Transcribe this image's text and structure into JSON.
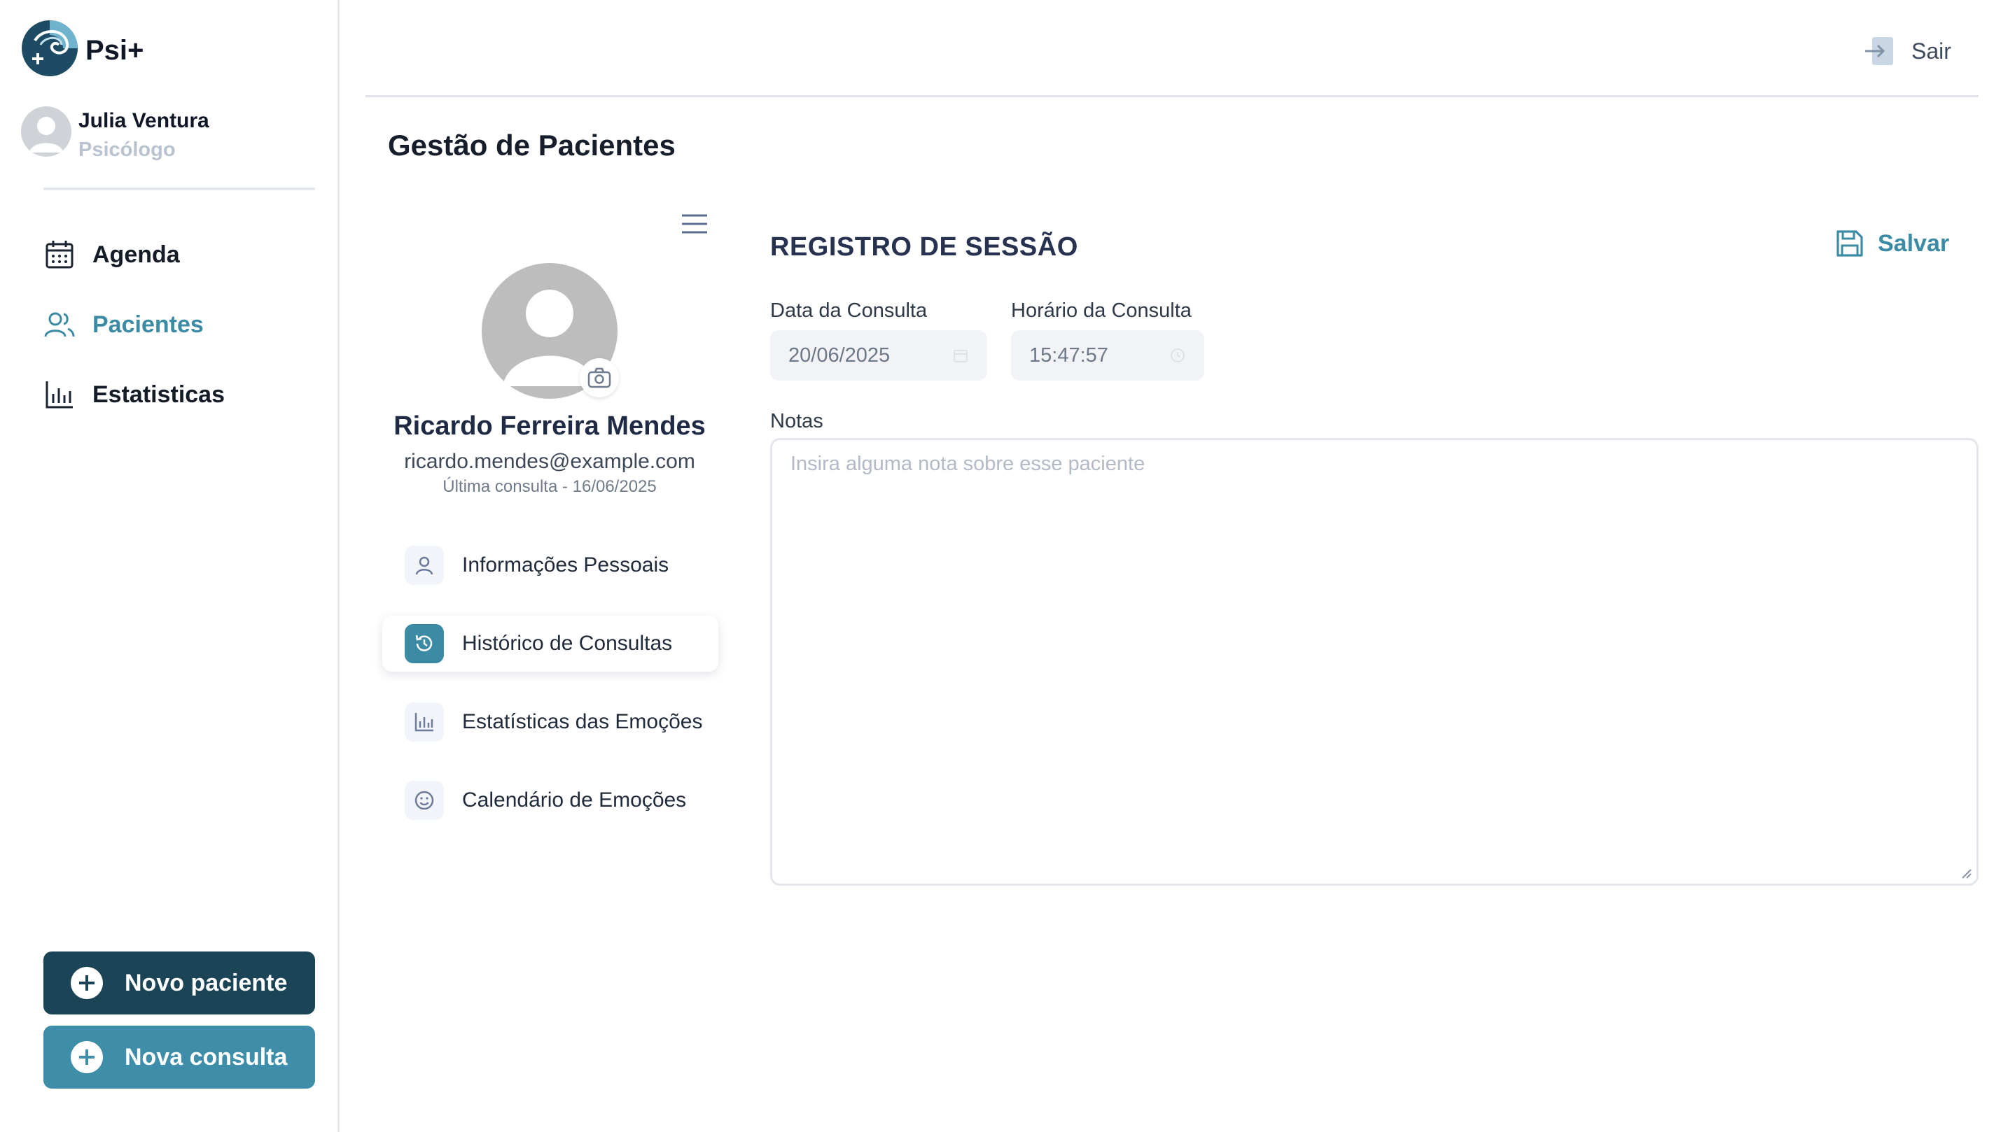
{
  "app": {
    "name": "Psi+"
  },
  "user": {
    "name": "Julia Ventura",
    "role": "Psicólogo"
  },
  "nav": {
    "items": [
      {
        "label": "Agenda",
        "icon": "calendar-icon"
      },
      {
        "label": "Pacientes",
        "icon": "users-icon",
        "active": true
      },
      {
        "label": "Estatisticas",
        "icon": "bar-chart-icon"
      }
    ]
  },
  "actions": {
    "new_patient": "Novo paciente",
    "new_appointment": "Nova consulta"
  },
  "topbar": {
    "logout": "Sair"
  },
  "page": {
    "title": "Gestão de Pacientes"
  },
  "patient": {
    "name": "Ricardo Ferreira Mendes",
    "email": "ricardo.mendes@example.com",
    "last_appointment": "Última consulta - 16/06/2025",
    "menu": [
      {
        "label": "Informações Pessoais",
        "icon": "user-icon"
      },
      {
        "label": "Histórico de Consultas",
        "icon": "history-icon",
        "active": true
      },
      {
        "label": "Estatísticas das Emoções",
        "icon": "bar-chart-icon"
      },
      {
        "label": "Calendário de Emoções",
        "icon": "smile-icon"
      }
    ]
  },
  "session": {
    "title": "REGISTRO DE SESSÃO",
    "save": "Salvar",
    "date_label": "Data da Consulta",
    "date_value": "20/06/2025",
    "time_label": "Horário da Consulta",
    "time_value": "15:47:57",
    "notes_label": "Notas",
    "notes_placeholder": "Insira alguma nota sobre esse paciente"
  },
  "colors": {
    "accent": "#3c8ba4",
    "primary_dark": "#1b4556",
    "accent_button": "#3f8ea9"
  }
}
